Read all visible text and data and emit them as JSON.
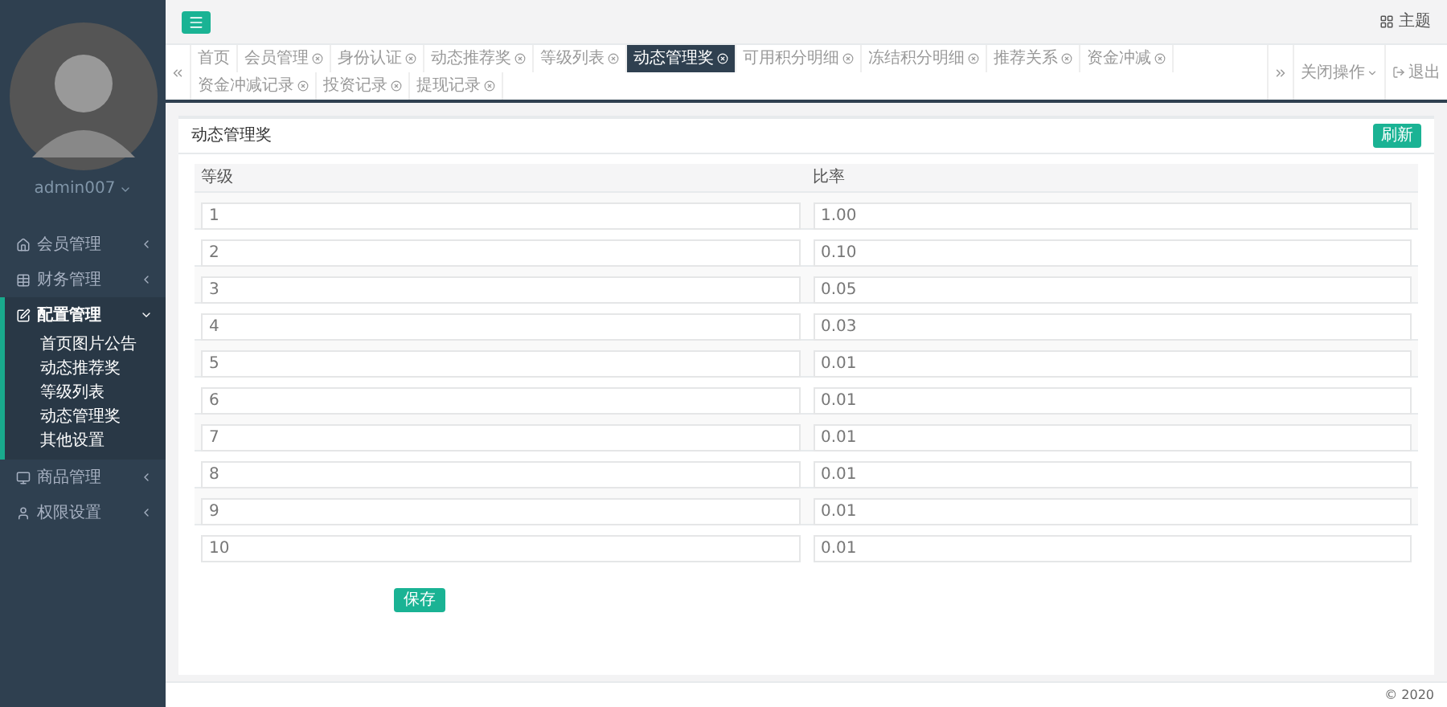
{
  "sidebar": {
    "username": "admin007",
    "menu": [
      {
        "label": "会员管理",
        "expanded": false
      },
      {
        "label": "财务管理",
        "expanded": false
      },
      {
        "label": "配置管理",
        "expanded": true,
        "children": [
          {
            "label": "首页图片公告"
          },
          {
            "label": "动态推荐奖"
          },
          {
            "label": "等级列表"
          },
          {
            "label": "动态管理奖"
          },
          {
            "label": "其他设置"
          }
        ]
      },
      {
        "label": "商品管理",
        "expanded": false
      },
      {
        "label": "权限设置",
        "expanded": false
      }
    ]
  },
  "topbar": {
    "theme": "主题"
  },
  "tabs": [
    {
      "label": "首页",
      "closable": false,
      "selected": false
    },
    {
      "label": "会员管理",
      "closable": true,
      "selected": false
    },
    {
      "label": "身份认证",
      "closable": true,
      "selected": false
    },
    {
      "label": "动态推荐奖",
      "closable": true,
      "selected": false
    },
    {
      "label": "等级列表",
      "closable": true,
      "selected": false
    },
    {
      "label": "动态管理奖",
      "closable": true,
      "selected": true
    },
    {
      "label": "可用积分明细",
      "closable": true,
      "selected": false
    },
    {
      "label": "冻结积分明细",
      "closable": true,
      "selected": false
    },
    {
      "label": "推荐关系",
      "closable": true,
      "selected": false
    },
    {
      "label": "资金冲减",
      "closable": true,
      "selected": false
    },
    {
      "label": "资金冲减记录",
      "closable": true,
      "selected": false
    },
    {
      "label": "投资记录",
      "closable": true,
      "selected": false
    },
    {
      "label": "提现记录",
      "closable": true,
      "selected": false
    }
  ],
  "tab_actions": {
    "close_menu": "关闭操作",
    "logout": "退出"
  },
  "card": {
    "title": "动态管理奖",
    "refresh": "刷新",
    "columns": [
      "等级",
      "比率"
    ],
    "rows": [
      [
        "1",
        "1.00"
      ],
      [
        "2",
        "0.10"
      ],
      [
        "3",
        "0.05"
      ],
      [
        "4",
        "0.03"
      ],
      [
        "5",
        "0.01"
      ],
      [
        "6",
        "0.01"
      ],
      [
        "7",
        "0.01"
      ],
      [
        "8",
        "0.01"
      ],
      [
        "9",
        "0.01"
      ],
      [
        "10",
        "0.01"
      ]
    ],
    "save": "保存"
  },
  "footer": "© 2020"
}
